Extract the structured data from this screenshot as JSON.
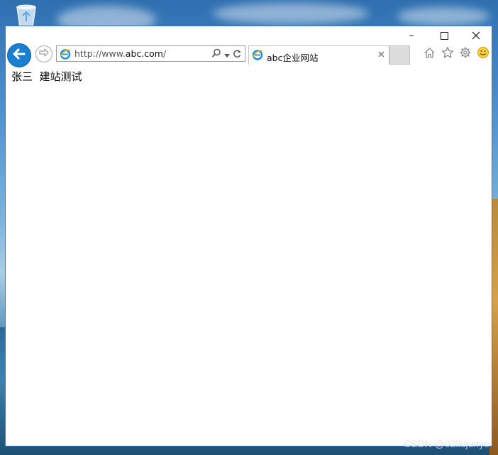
{
  "window": {
    "minimize_symbol": "–",
    "maximize_symbol": "☐",
    "close_symbol": "✕"
  },
  "navigation": {
    "address_url_prefix": "http://www.",
    "address_url_domain": "abc.com",
    "address_url_suffix": "/"
  },
  "tab": {
    "title": "abc企业网站"
  },
  "toolbar_icons": [
    "home-icon",
    "favorites-star-icon",
    "settings-gear-icon",
    "feedback-smiley-icon"
  ],
  "page": {
    "body_text": "张三  建站测试"
  },
  "desktop": {
    "watermark": "CSDN @02liujunye"
  },
  "colors": {
    "back_button": "#1a7fd0",
    "window_border": "#3a78c2",
    "new_tab": "#dcdcdc"
  }
}
